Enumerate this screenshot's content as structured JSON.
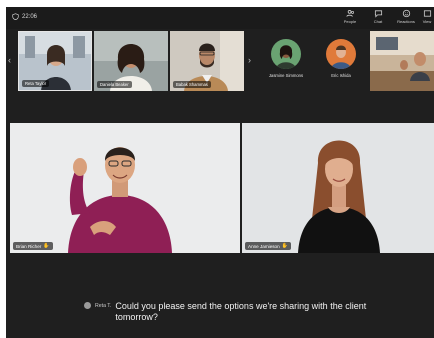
{
  "topbar": {
    "timer": "22:06",
    "controls": [
      {
        "label": "People",
        "icon": "people-icon"
      },
      {
        "label": "Chat",
        "icon": "chat-icon"
      },
      {
        "label": "Reactions",
        "icon": "reactions-icon"
      },
      {
        "label": "View",
        "icon": "view-icon"
      }
    ]
  },
  "strip": {
    "tiles": [
      {
        "name": "Reta Taylor"
      },
      {
        "name": "Daniela Beaker"
      },
      {
        "name": "Babak Shammas"
      }
    ],
    "avatars": [
      {
        "name": "Jasmine Simmons"
      },
      {
        "name": "Eric Ishida"
      }
    ]
  },
  "stage": {
    "left": {
      "name": "Brian Richer"
    },
    "right": {
      "name": "Anne Jamieson"
    }
  },
  "caption": {
    "speaker": "Reta T.",
    "text": "Could you please send the options we're sharing with the client tomorrow?"
  }
}
